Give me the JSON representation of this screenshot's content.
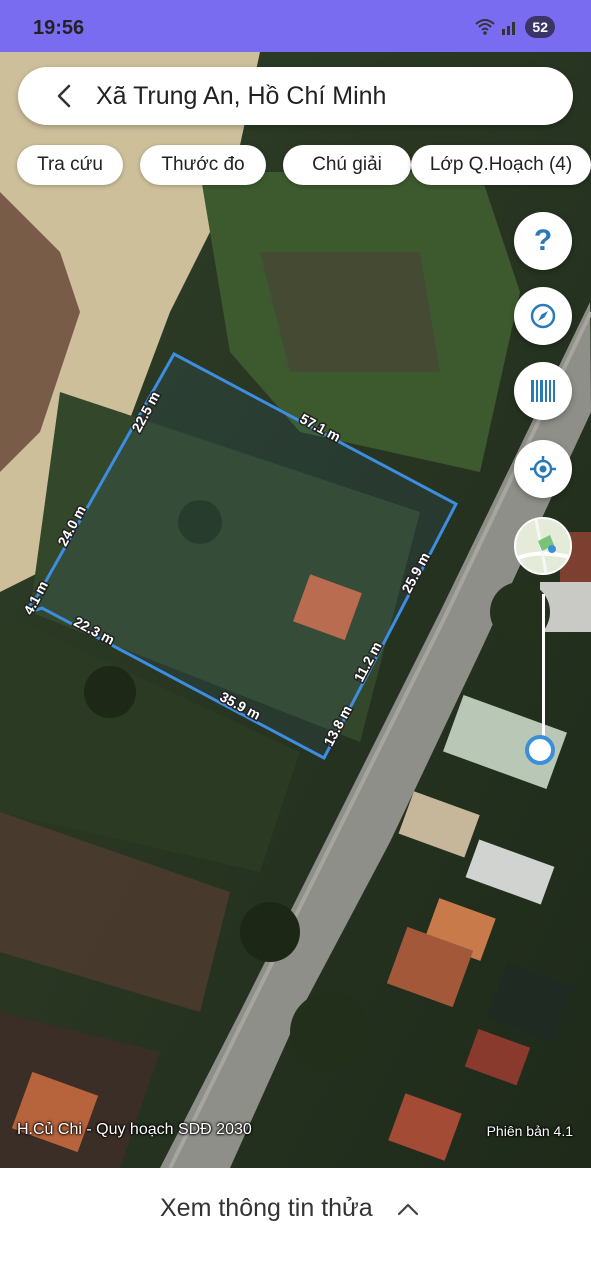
{
  "status_bar": {
    "time": "19:56",
    "battery": "52"
  },
  "search": {
    "title": "Xã Trung An, Hồ Chí Minh"
  },
  "chips": [
    {
      "label": "Tra cứu"
    },
    {
      "label": "Thước đo"
    },
    {
      "label": "Chú giải"
    },
    {
      "label": "Lớp Q.Hoạch (4)"
    }
  ],
  "fab": {
    "help": "?"
  },
  "measurements": [
    "22.5 m",
    "57.1 m",
    "24.0 m",
    "25.9 m",
    "4.1 m",
    "22.3 m",
    "11.2 m",
    "35.9 m",
    "13.8 m"
  ],
  "footer": {
    "layer_name": "H.Củ Chi - Quy hoạch SDĐ 2030",
    "version": "Phiên bản 4.1"
  },
  "bottom_sheet": {
    "label": "Xem thông tin thửa"
  },
  "colors": {
    "status_bar": "#7a6cf0",
    "polygon": "#3d8de0",
    "accent": "#2a7ab8"
  }
}
